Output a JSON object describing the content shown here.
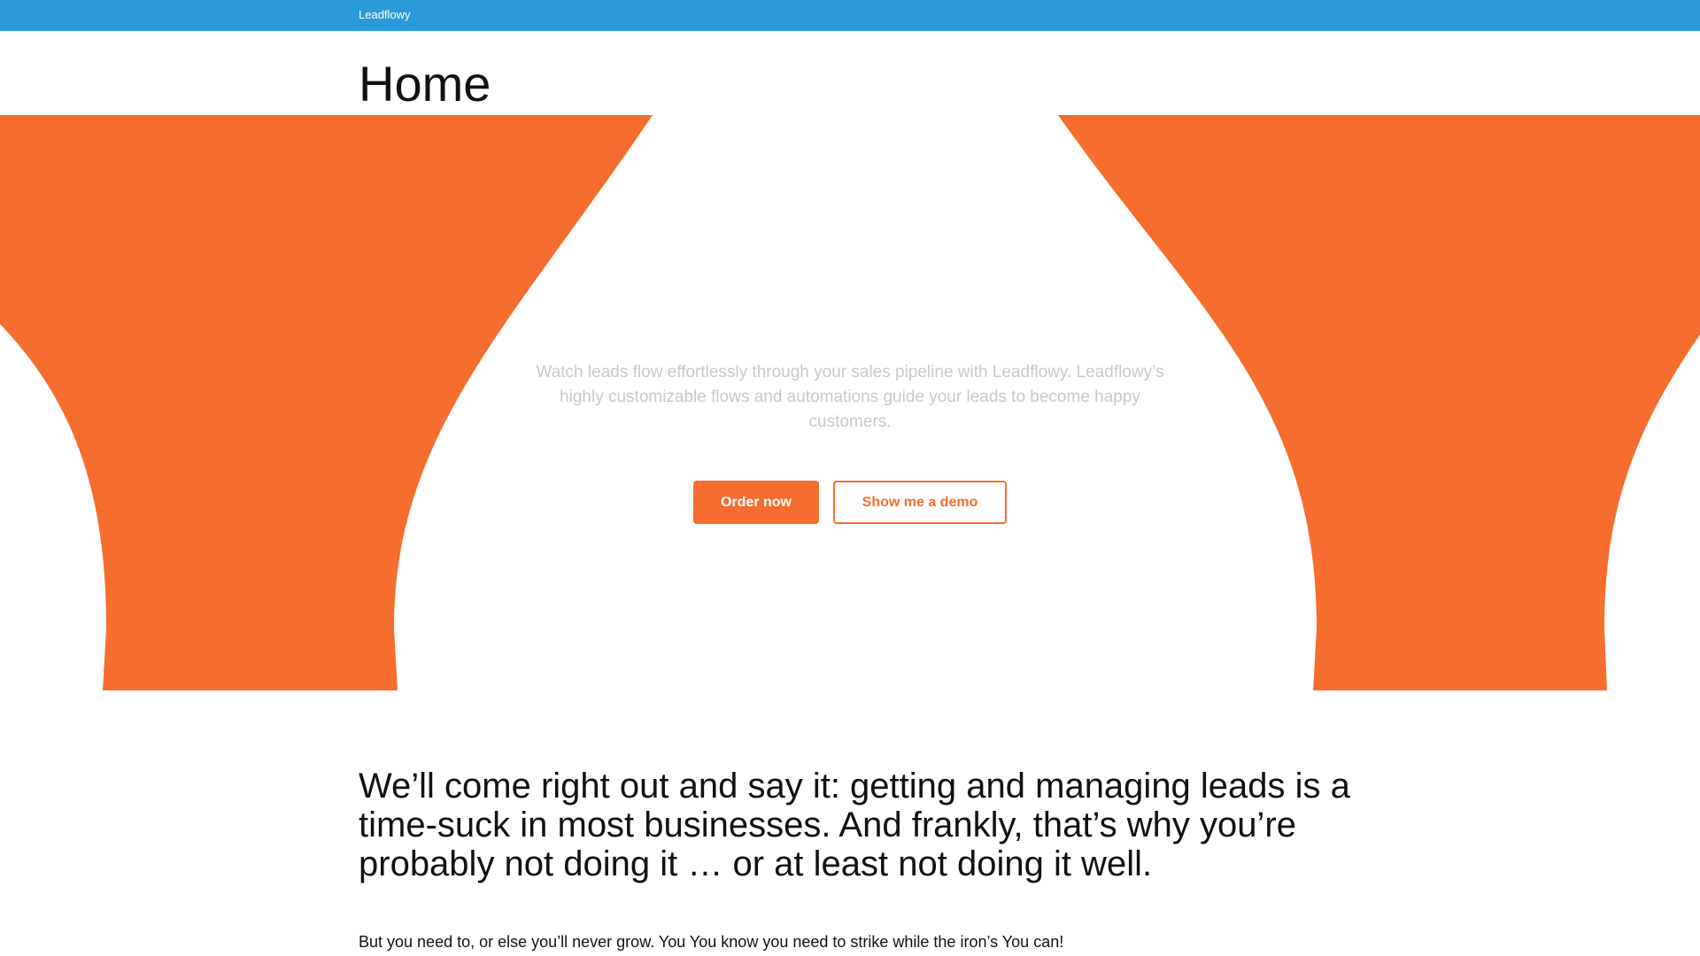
{
  "header": {
    "brand": "Leadflowy"
  },
  "page": {
    "title": "Home"
  },
  "hero": {
    "description": "Watch leads flow effortlessly through your sales pipeline with Leadflowy. Leadflowy’s highly customizable flows and automations guide your leads to become happy customers.",
    "primary_button": "Order now",
    "secondary_button": "Show me a demo"
  },
  "content": {
    "headline": "We’ll come right out and say it: getting and managing leads is a time-suck in most businesses. And frankly, that’s why you’re probably not doing it … or at least not doing it well.",
    "body": "But you need to, or else you’ll never grow. You  You know you need to strike while the iron’s      You can!"
  },
  "colors": {
    "topbar": "#2a9ad8",
    "accent": "#f56e2f",
    "text": "#111111",
    "muted": "#c9c9c9"
  }
}
